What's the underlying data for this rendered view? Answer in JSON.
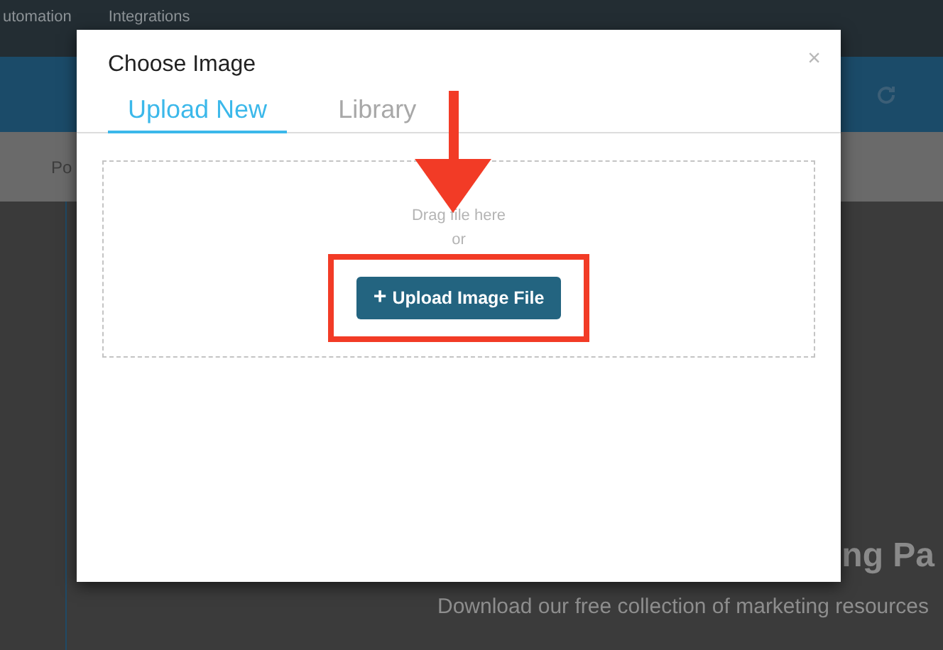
{
  "top_nav": {
    "items": [
      {
        "label": "utomation"
      },
      {
        "label": "Integrations"
      }
    ]
  },
  "sub_nav": {
    "label": "Po"
  },
  "hero": {
    "heading": "ng Pa",
    "subtitle": "Download our free collection of marketing resources"
  },
  "modal": {
    "title": "Choose Image",
    "close": "×",
    "tabs": [
      {
        "label": "Upload New",
        "selected": true
      },
      {
        "label": "Library",
        "selected": false
      }
    ],
    "dropzone": {
      "hint": "Drag file here",
      "or": "or",
      "button": {
        "icon": "+",
        "label": "Upload Image File"
      }
    }
  }
}
